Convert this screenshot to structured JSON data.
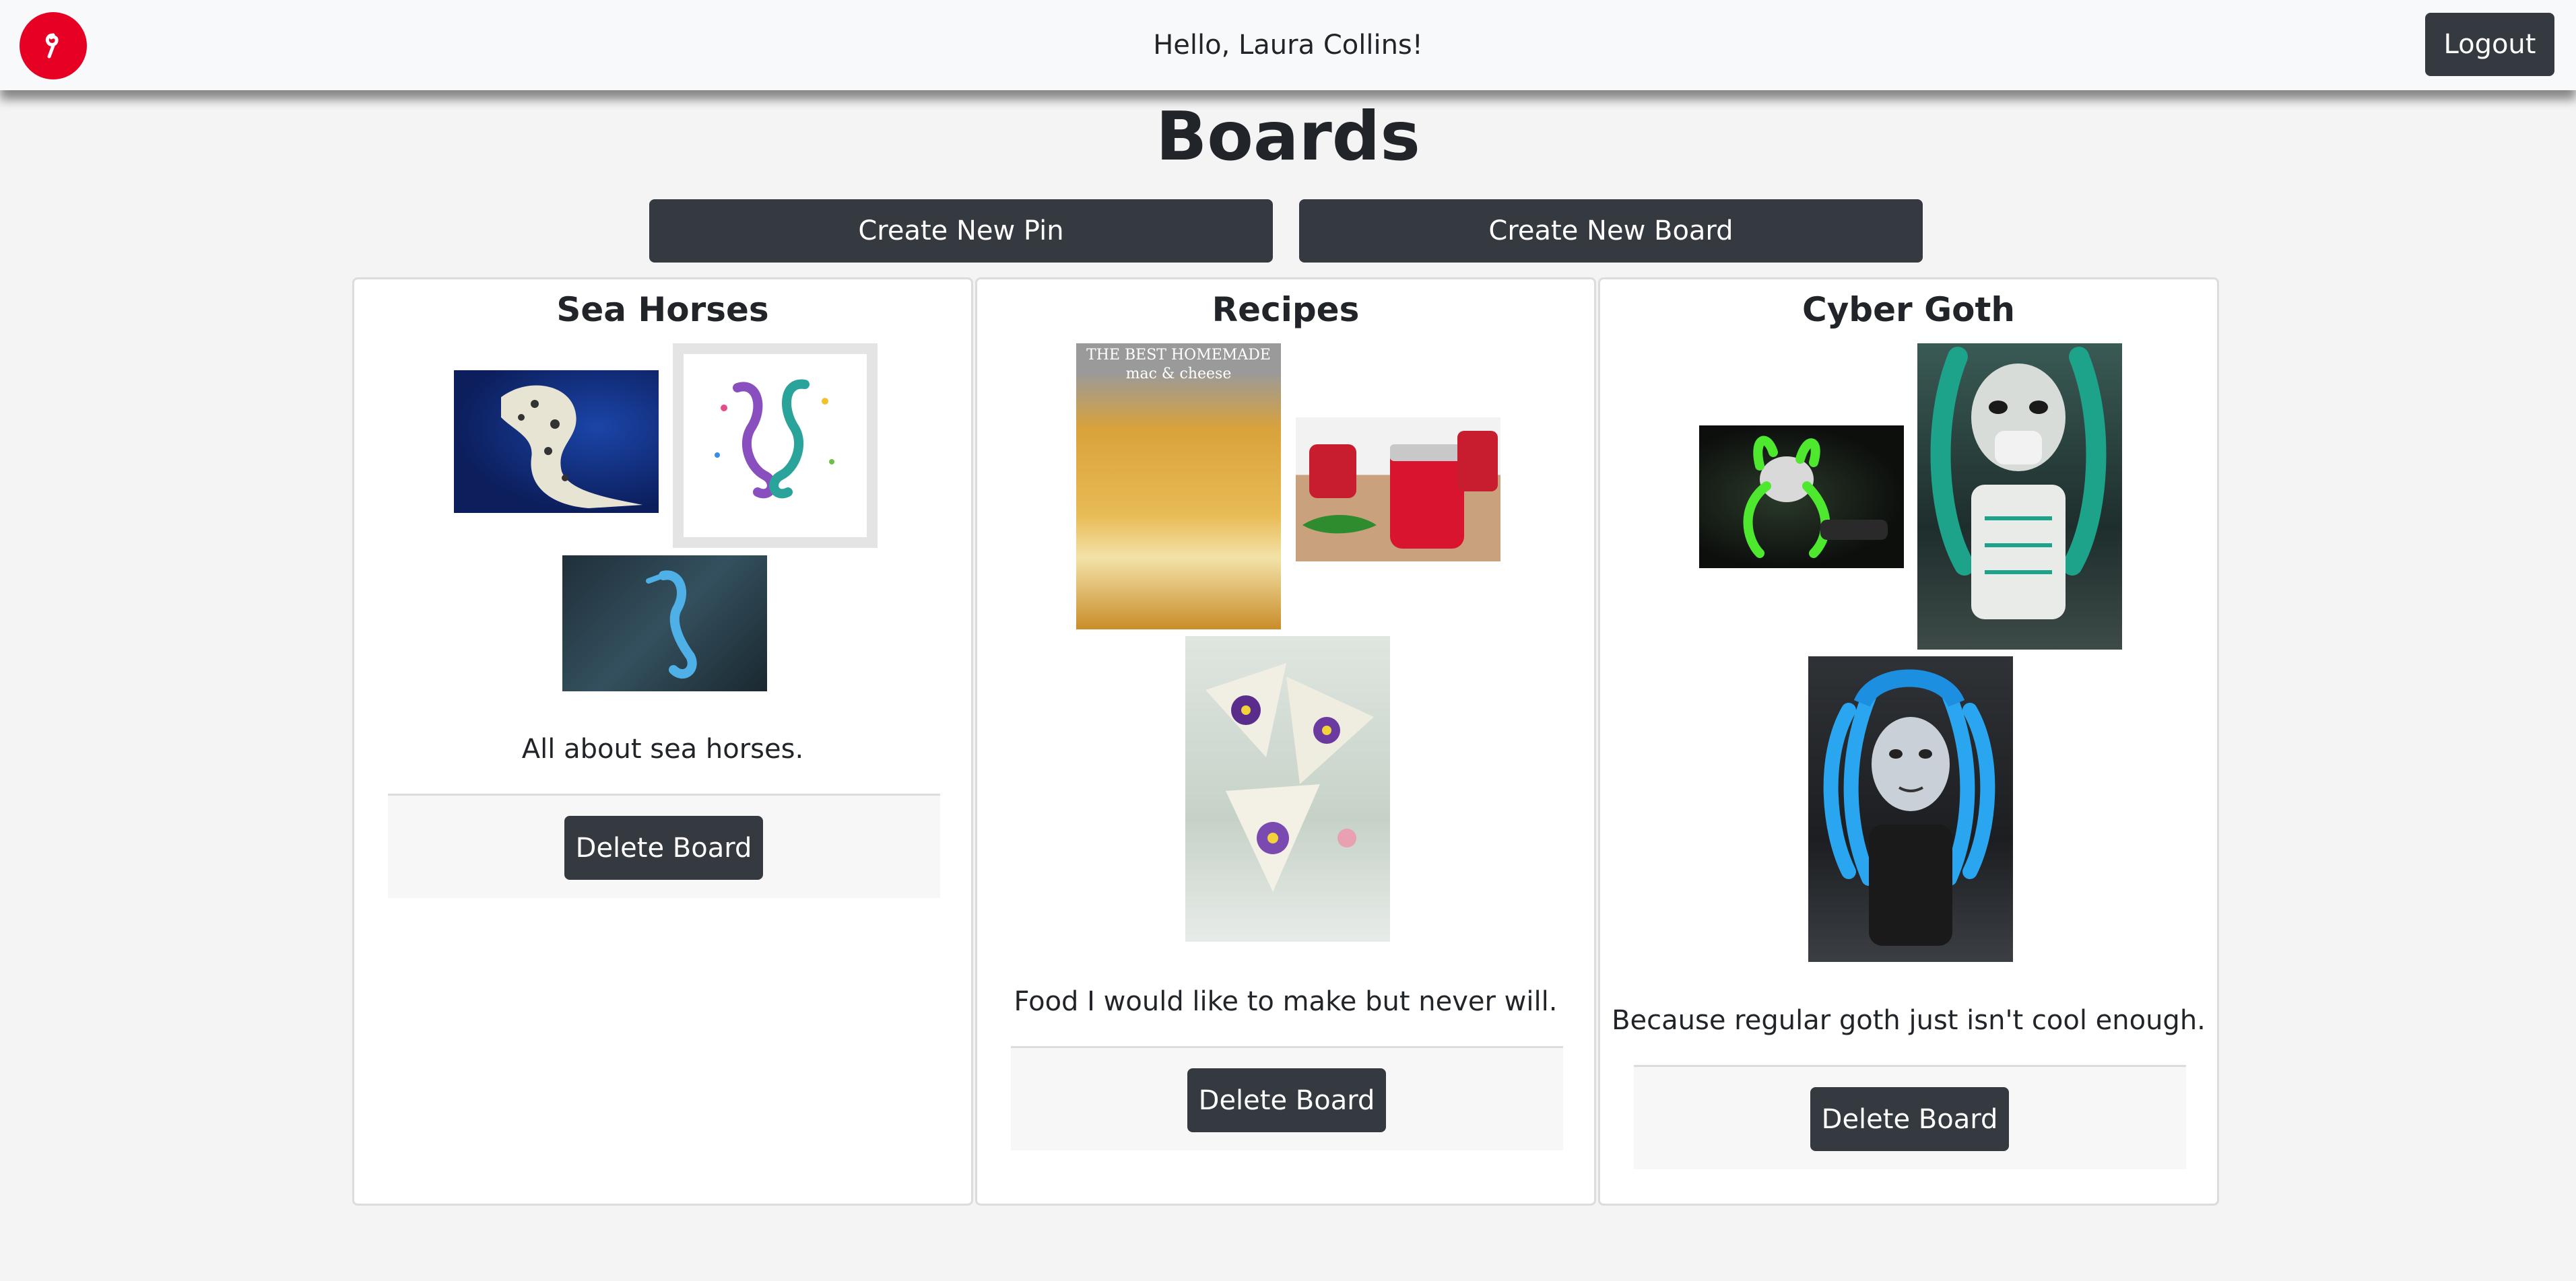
{
  "header": {
    "greeting": "Hello, Laura Collins!",
    "logout_label": "Logout",
    "logo_icon": "pinterest-logo-icon",
    "brand_color": "#e60023"
  },
  "page": {
    "title": "Boards",
    "create_pin_label": "Create New Pin",
    "create_board_label": "Create New Board"
  },
  "boards": [
    {
      "title": "Sea Horses",
      "description": "All about sea horses.",
      "delete_label": "Delete Board",
      "images": [
        "seahorse-photo",
        "seahorse-watercolor-illustration",
        "blue-seahorse-underwater-photo"
      ]
    },
    {
      "title": "Recipes",
      "description": "Food I would like to make but never will.",
      "delete_label": "Delete Board",
      "images": [
        "mac-and-cheese-photo",
        "pepper-jelly-jars-photo",
        "flower-tea-sandwiches-photo"
      ],
      "image_caption": "THE BEST HOMEMADE mac & cheese"
    },
    {
      "title": "Cyber Goth",
      "description": "Because regular goth just isn't cool enough.",
      "delete_label": "Delete Board",
      "images": [
        "green-cybergoth-photo",
        "white-mask-cybergoth-photo",
        "blue-dreads-cybergoth-photo"
      ]
    }
  ]
}
